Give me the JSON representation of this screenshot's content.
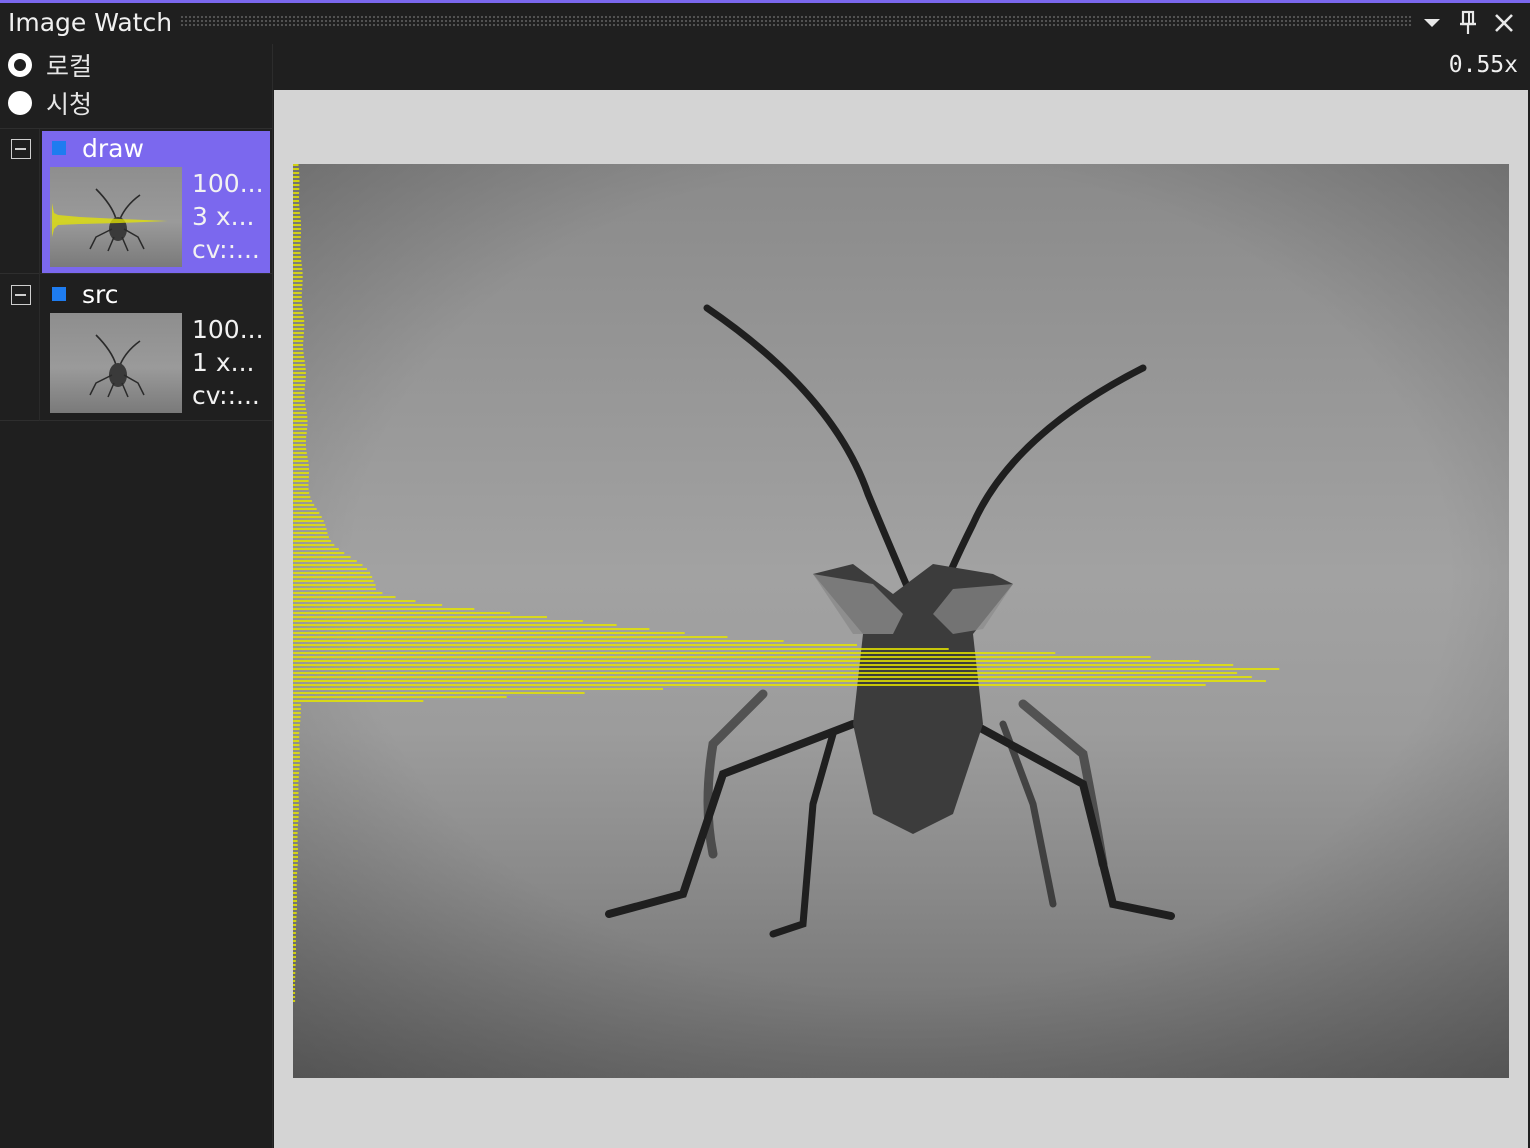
{
  "window": {
    "title": "Image Watch",
    "accent_color": "#7b68ee",
    "buttons": [
      {
        "name": "dropdown-icon"
      },
      {
        "name": "pin-icon"
      },
      {
        "name": "close-icon"
      }
    ]
  },
  "scope": {
    "options": [
      {
        "label": "로컬",
        "selected": true
      },
      {
        "label": "시청",
        "selected": false
      }
    ]
  },
  "watch_list": [
    {
      "name": "draw",
      "selected": true,
      "meta": [
        "100...",
        "3 x...",
        "cv::..."
      ],
      "icon_color": "#1e7cf0"
    },
    {
      "name": "src",
      "selected": false,
      "meta": [
        "100...",
        "1 x...",
        "cv::..."
      ],
      "icon_color": "#1e7cf0"
    }
  ],
  "viewer": {
    "zoom": "0.55x",
    "histogram_color": "#e6e600"
  }
}
